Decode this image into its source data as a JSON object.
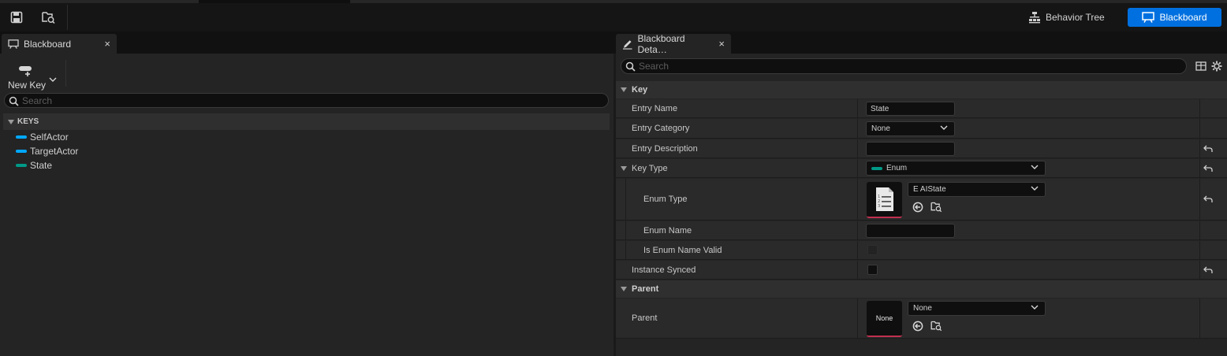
{
  "toolbar": {
    "save_icon": "save-icon",
    "browse_icon": "browse-asset-icon",
    "behavior_tree_label": "Behavior Tree",
    "blackboard_label": "Blackboard",
    "accent_color": "#0070e0"
  },
  "left_panel": {
    "tab_label": "Blackboard",
    "new_key_label": "New Key",
    "search_placeholder": "Search",
    "keys_header": "KEYS",
    "keys": [
      {
        "label": "SelfActor",
        "color": "#00a8ff"
      },
      {
        "label": "TargetActor",
        "color": "#00a8ff"
      },
      {
        "label": "State",
        "color": "#009987"
      }
    ]
  },
  "right_panel": {
    "tab_label": "Blackboard Deta…",
    "search_placeholder": "Search",
    "categories": {
      "key": "Key",
      "parent": "Parent"
    },
    "rows": {
      "entry_name": {
        "label": "Entry Name",
        "value": "State"
      },
      "entry_category": {
        "label": "Entry Category",
        "value": "None"
      },
      "entry_description": {
        "label": "Entry Description",
        "value": ""
      },
      "key_type": {
        "label": "Key Type",
        "value": "Enum"
      },
      "enum_type": {
        "label": "Enum Type",
        "value": "E AIState"
      },
      "enum_name": {
        "label": "Enum Name",
        "value": ""
      },
      "is_enum_name_valid": {
        "label": "Is Enum Name Valid"
      },
      "instance_synced": {
        "label": "Instance Synced"
      },
      "parent": {
        "label": "Parent",
        "value": "None",
        "thumb_label": "None"
      }
    }
  }
}
